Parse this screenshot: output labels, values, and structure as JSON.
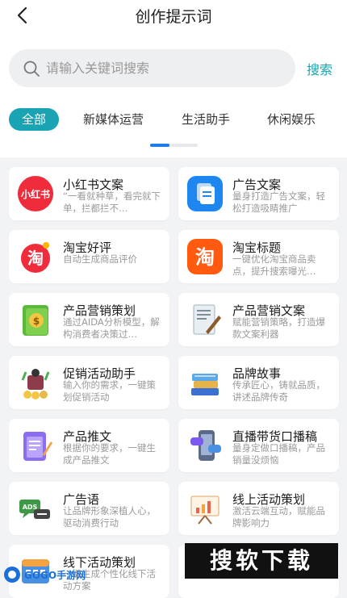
{
  "header": {
    "title": "创作提示词"
  },
  "search": {
    "placeholder": "请输入关键词搜索",
    "button": "搜索"
  },
  "tabs": [
    "全部",
    "新媒体运营",
    "生活助手",
    "休闲娱乐"
  ],
  "cards": [
    {
      "title": "小红书文案",
      "desc": "“一看就种草，看完就下单，拦都拦不…",
      "icon": "xiaohongshu-icon",
      "icon_text": "小红书"
    },
    {
      "title": "广告文案",
      "desc": "量身打造广告文案，轻松打造吸睛推广",
      "icon": "document-icon"
    },
    {
      "title": "淘宝好评",
      "desc": "自动生成商品评价",
      "icon": "taobao-icon",
      "icon_text": "淘"
    },
    {
      "title": "淘宝标题",
      "desc": "一键优化淘宝商品卖点，提升搜索曝光…",
      "icon": "taobao-icon",
      "icon_text": "淘"
    },
    {
      "title": "产品营销策划",
      "desc": "通过AIDA分析模型，解构消费者决策过…",
      "icon": "money-book-icon"
    },
    {
      "title": "产品营销文案",
      "desc": "赋能营销策略，打造爆款文案利器",
      "icon": "paper-pen-icon"
    },
    {
      "title": "促销活动助手",
      "desc": "输入你的需求，一键策划促销活动",
      "icon": "shopping-icon"
    },
    {
      "title": "品牌故事",
      "desc": "传承匠心，铸就品质，讲述品牌传奇",
      "icon": "books-icon"
    },
    {
      "title": "产品推文",
      "desc": "根据你的要求，一键生成产品推文",
      "icon": "notepad-icon"
    },
    {
      "title": "直播带货口播稿",
      "desc": "量身定做口播稿，产品销量没烦恼",
      "icon": "phone-live-icon"
    },
    {
      "title": "广告语",
      "desc": "让品牌形象深植人心，驱动消费行动",
      "icon": "ads-chat-icon",
      "icon_text": "ADS"
    },
    {
      "title": "线上活动策划",
      "desc": "激活云端互动，赋能品牌影响力",
      "icon": "presentation-icon"
    },
    {
      "title": "线下活动策划",
      "desc": "一键生成个性化线下活动方案",
      "icon": "calendar-icon"
    },
    {
      "title": "",
      "desc": "",
      "icon": ""
    }
  ],
  "watermark": {
    "text": "搜软下载"
  },
  "logo": {
    "text": "GOGO手游网"
  },
  "colors": {
    "accent": "#1aa3b3",
    "indicator": "#1d7fe6",
    "background": "#f2f3f5"
  }
}
